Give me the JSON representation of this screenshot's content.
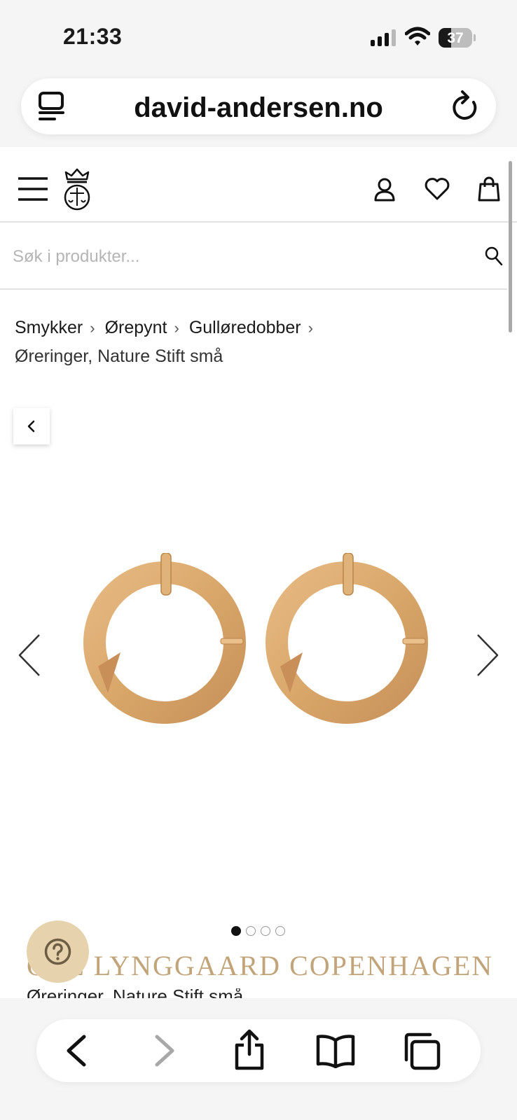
{
  "status_bar": {
    "time": "21:33",
    "battery_level": "37",
    "icons": [
      "cellular-signal-icon",
      "wifi-icon",
      "battery-icon"
    ]
  },
  "browser": {
    "url": "david-andersen.no",
    "icons": [
      "reader-mode-icon",
      "reload-icon"
    ]
  },
  "header": {
    "icons": [
      "hamburger-menu-icon",
      "crown-logo-icon",
      "account-icon",
      "wishlist-heart-icon",
      "shopping-bag-icon"
    ]
  },
  "search": {
    "placeholder": "Søk i produkter..."
  },
  "breadcrumb": {
    "items": [
      "Smykker",
      "Ørepynt",
      "Gulløredobber"
    ],
    "separator": "›",
    "current": "Øreringer, Nature Stift små"
  },
  "gallery": {
    "image_count": 4,
    "active_index": 0,
    "image_description": "gold-hoop-earrings"
  },
  "product": {
    "brand": "OLE LYNGGAARD COPENHAGEN",
    "name": "Øreringer, Nature Stift små"
  },
  "help": {
    "icon": "question-mark-icon"
  },
  "colors": {
    "brand_gold": "#c1a47a",
    "help_button": "#e6d3ae",
    "earring_gold": "#d9a76a"
  },
  "toolbar": {
    "icons": [
      "back-arrow-icon",
      "forward-arrow-icon",
      "share-icon",
      "bookmarks-icon",
      "tabs-icon"
    ]
  }
}
